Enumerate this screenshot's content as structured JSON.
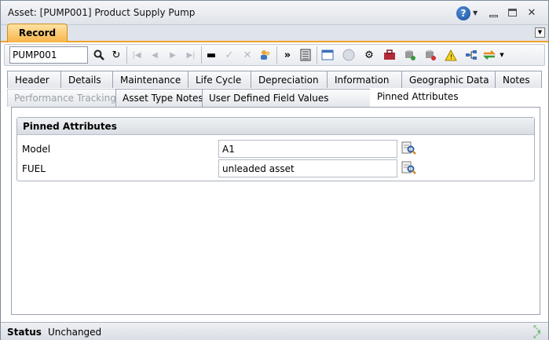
{
  "window": {
    "title": "Asset: [PUMP001] Product Supply Pump"
  },
  "record_tab": {
    "label": "Record"
  },
  "toolbar": {
    "asset_value": "PUMP001"
  },
  "tabs_row1": [
    {
      "label": "Header"
    },
    {
      "label": "Details"
    },
    {
      "label": "Maintenance"
    },
    {
      "label": "Life Cycle"
    },
    {
      "label": "Depreciation"
    },
    {
      "label": "Information"
    },
    {
      "label": "Geographic Data"
    },
    {
      "label": "Notes"
    }
  ],
  "tabs_row2": [
    {
      "label": "Performance Tracking"
    },
    {
      "label": "Asset Type Notes"
    },
    {
      "label": "User Defined Field Values"
    },
    {
      "label": "Pinned Attributes"
    }
  ],
  "pinned": {
    "header": "Pinned Attributes",
    "rows": [
      {
        "label": "Model",
        "value": "A1"
      },
      {
        "label": "FUEL",
        "value": "unleaded asset"
      }
    ]
  },
  "status": {
    "label": "Status",
    "value": "Unchanged"
  },
  "colors": {
    "accent": "#f7b448",
    "border": "#9aa2b0"
  }
}
